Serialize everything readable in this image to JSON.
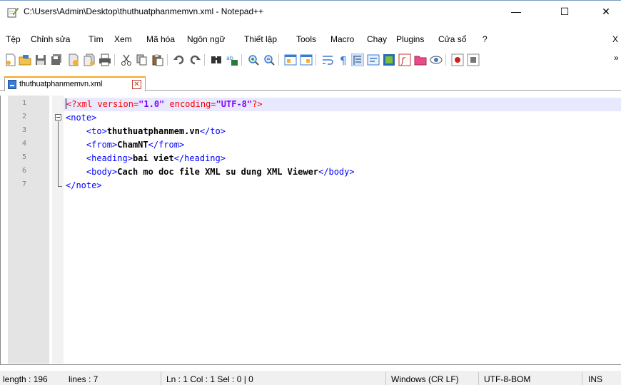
{
  "window": {
    "title": "C:\\Users\\Admin\\Desktop\\thuthuatphanmemvn.xml - Notepad++",
    "minimize_glyph": "—",
    "maximize_glyph": "☐",
    "close_glyph": "✕"
  },
  "menu": {
    "items": [
      "Tệp",
      "Chỉnh sửa",
      "Tìm",
      "Xem",
      "Mã hóa",
      "Ngôn ngữ",
      "Thiết lập",
      "Tools",
      "Macro",
      "Chạy",
      "Plugins",
      "Cửa sổ",
      "?"
    ],
    "close_doc": "X"
  },
  "toolbar": {
    "buttons": [
      "new-file-icon",
      "open-file-icon",
      "save-icon",
      "save-all-icon",
      "close-icon",
      "close-all-icon",
      "print-icon",
      "cut-icon",
      "copy-icon",
      "paste-icon",
      "undo-icon",
      "redo-icon",
      "find-icon",
      "replace-icon",
      "zoom-in-icon",
      "zoom-out-icon",
      "sync-vertical-icon",
      "sync-horizontal-icon",
      "word-wrap-icon",
      "show-all-characters-icon",
      "indent-guide-icon",
      "user-language-icon",
      "document-map-icon",
      "function-list-icon",
      "folder-workspace-icon",
      "monitoring-icon",
      "record-macro-icon",
      "stop-macro-icon"
    ],
    "overflow": "»"
  },
  "tab": {
    "label": "thuthuatphanmemvn.xml",
    "close_glyph": "✕"
  },
  "colors": {
    "tag": "#0000ff",
    "processing_instruction": "#ff0000",
    "attribute_value": "#8000ff",
    "current_line": "#e8e8ff",
    "tab_accent": "#f6a623"
  },
  "editor": {
    "line_numbers": [
      "1",
      "2",
      "3",
      "4",
      "5",
      "6",
      "7"
    ],
    "lines": [
      {
        "indent": "",
        "open": "<?xml",
        "attr1": " version=",
        "val1": "\"1.0\"",
        "attr2": " encoding=",
        "val2": "\"UTF-8\"",
        "close": "?>"
      },
      {
        "indent": "",
        "tag": "<note>"
      },
      {
        "indent": "    ",
        "open": "<to>",
        "text": "thuthuatphanmem.vn",
        "close": "</to>"
      },
      {
        "indent": "    ",
        "open": "<from>",
        "text": "ChamNT",
        "close": "</from>"
      },
      {
        "indent": "    ",
        "open": "<heading>",
        "text": "bai viet",
        "close": "</heading>"
      },
      {
        "indent": "    ",
        "open": "<body>",
        "text": "Cach mo doc file XML su dung XML Viewer",
        "close": "</body>"
      },
      {
        "indent": "",
        "tag": "</note>"
      }
    ]
  },
  "status": {
    "length": "length : 196",
    "lines": "lines : 7",
    "position": "Ln : 1    Col : 1    Sel : 0 | 0",
    "eol": "Windows (CR LF)",
    "encoding": "UTF-8-BOM",
    "mode": "INS"
  }
}
